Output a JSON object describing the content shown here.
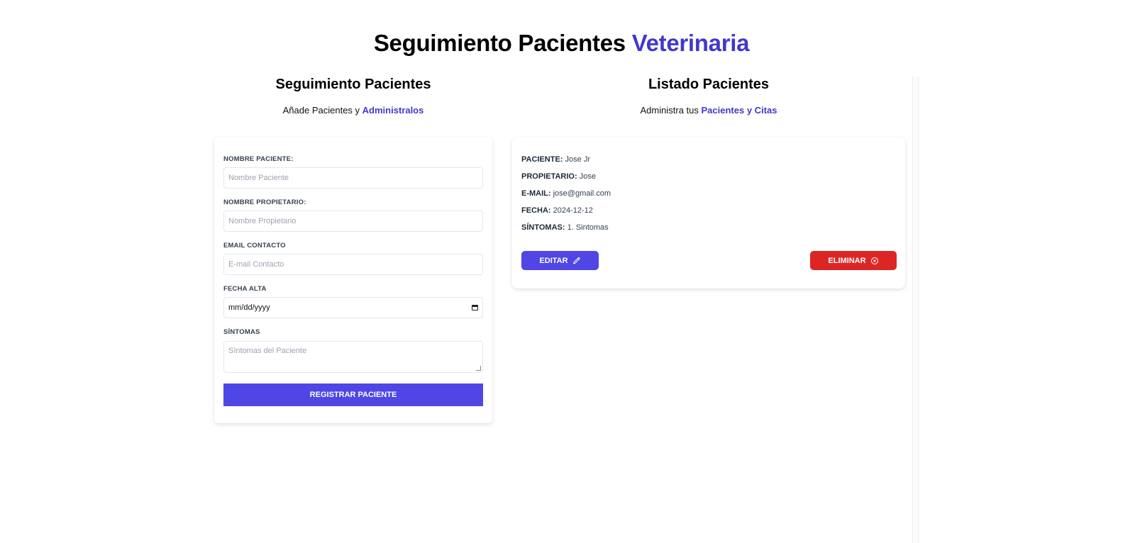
{
  "header": {
    "title_main": "Seguimiento Pacientes",
    "title_accent": "Veterinaria",
    "accent_color": "#4338ca"
  },
  "form_section": {
    "title": "Seguimiento Pacientes",
    "subtitle_prefix": "Añade Pacientes y",
    "subtitle_highlight": "Administralos",
    "fields": {
      "patient_name": {
        "label": "Nombre Paciente:",
        "placeholder": "Nombre Paciente",
        "value": ""
      },
      "owner_name": {
        "label": "Nombre Propietario:",
        "placeholder": "Nombre Propietario",
        "value": ""
      },
      "email": {
        "label": "Email Contacto",
        "placeholder": "E-mail Contacto",
        "value": ""
      },
      "date": {
        "label": "Fecha Alta",
        "value": "mm/dd/yyyy",
        "icon": "calendar-icon"
      },
      "symptoms": {
        "label": "Síntomas",
        "placeholder": "Síntomas del Paciente",
        "value": ""
      }
    },
    "submit_label": "Registrar Paciente",
    "submit_color": "#4f46e5"
  },
  "list_section": {
    "title": "Listado Pacientes",
    "subtitle_prefix": "Administra tus",
    "subtitle_highlight": "Pacientes y Citas",
    "patients": [
      {
        "patient_label": "Paciente:",
        "patient": "Jose Jr",
        "owner_label": "Propietario:",
        "owner": "Jose",
        "email_label": "E-mail:",
        "email": "jose@gmail.com",
        "date_label": "Fecha:",
        "date": "2024-12-12",
        "symptoms_label": "Síntomas:",
        "symptoms": "1. Sintomas",
        "edit_label": "Editar",
        "edit_icon": "pencil-icon",
        "edit_color": "#4f46e5",
        "delete_label": "Eliminar",
        "delete_icon": "x-circle-icon",
        "delete_color": "#dc2626"
      }
    ]
  }
}
